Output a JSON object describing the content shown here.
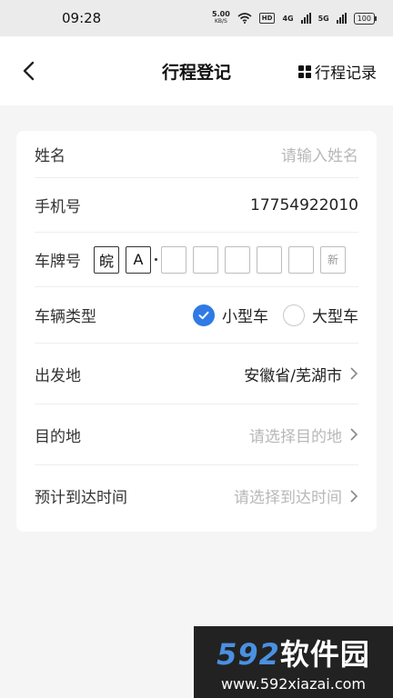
{
  "status_bar": {
    "time": "09:28",
    "speed_value": "5.00",
    "speed_unit": "KB/S",
    "hd_badge": "HD",
    "net_4g": "4G",
    "net_5g": "5G",
    "battery": "100"
  },
  "nav": {
    "title": "行程登记",
    "records_label": "行程记录"
  },
  "form": {
    "name_label": "姓名",
    "name_placeholder": "请输入姓名",
    "phone_label": "手机号",
    "phone_value": "17754922010",
    "plate_label": "车牌号",
    "plate_province": "皖",
    "plate_letter": "A",
    "plate_new": "新",
    "vehicle_type_label": "车辆类型",
    "vehicle_small": "小型车",
    "vehicle_large": "大型车",
    "departure_label": "出发地",
    "departure_value": "安徽省/芜湖市",
    "destination_label": "目的地",
    "destination_placeholder": "请选择目的地",
    "arrival_label": "预计到达时间",
    "arrival_placeholder": "请选择到达时间"
  },
  "watermark": {
    "brand_num": "592",
    "brand_text": "软件园",
    "url": "www.592xiazai.com"
  },
  "colors": {
    "accent": "#2f7ae5",
    "placeholder": "#b8b8b8"
  }
}
